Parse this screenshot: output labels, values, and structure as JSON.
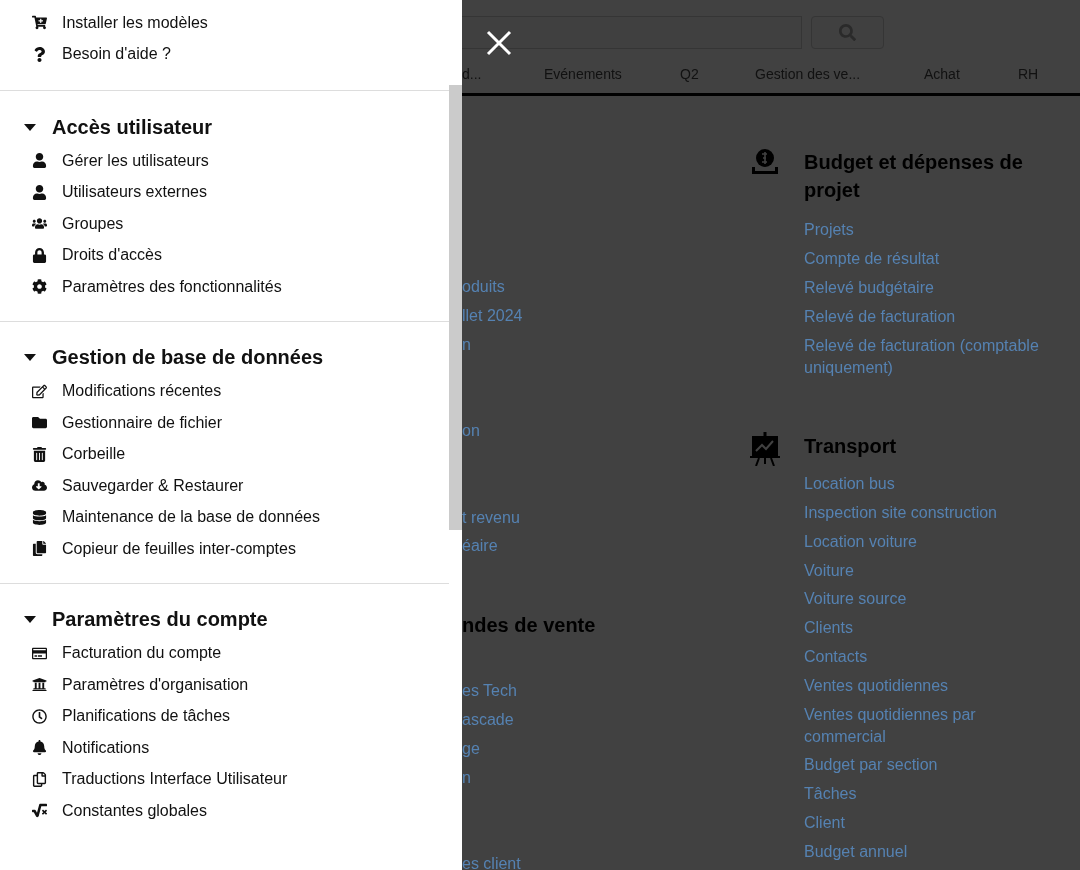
{
  "drawer": {
    "top_items": [
      {
        "label": "Installer les modèles"
      },
      {
        "label": "Besoin d'aide ?"
      }
    ],
    "sections": [
      {
        "title": "Accès utilisateur",
        "expanded": true,
        "items": [
          "Gérer les utilisateurs",
          "Utilisateurs externes",
          "Groupes",
          "Droits d'accès",
          "Paramètres des fonctionnalités"
        ]
      },
      {
        "title": "Gestion de base de données",
        "expanded": true,
        "items": [
          "Modifications récentes",
          "Gestionnaire de fichier",
          "Corbeille",
          "Sauvegarder & Restaurer",
          "Maintenance de la base de données",
          "Copieur de feuilles inter-comptes"
        ]
      },
      {
        "title": "Paramètres du compte",
        "expanded": true,
        "items": [
          "Facturation du compte",
          "Paramètres d'organisation",
          "Planifications de tâches",
          "Notifications",
          "Traductions Interface Utilisateur",
          "Constantes globales"
        ]
      }
    ]
  },
  "tabs": [
    "d...",
    "Evénements",
    "Q2",
    "Gestion des ve...",
    "Achat",
    "RH"
  ],
  "left_column": {
    "groups": [
      [
        "oduits",
        "llet 2024",
        "n"
      ],
      [
        "on"
      ],
      [
        "t revenu",
        "éaire"
      ]
    ],
    "section": {
      "title": "ndes de vente",
      "groups": [
        [
          "es Tech",
          "ascade",
          "ge",
          "n"
        ],
        [
          "es client"
        ]
      ]
    }
  },
  "right_column": [
    {
      "title": "Budget et dépenses de projet",
      "links": [
        "Projets",
        "Compte de résultat",
        "Relevé budgétaire",
        "Relevé de facturation",
        "Relevé de facturation (comptable uniquement)"
      ]
    },
    {
      "title": "Transport",
      "links": [
        "Location bus",
        "Inspection site construction",
        "Location voiture",
        "Voiture",
        "Voiture source",
        "Clients",
        "Contacts",
        "Ventes quotidiennes",
        "Ventes quotidiennes par commercial",
        "Budget par section",
        "Tâches",
        "Client",
        "Budget annuel"
      ]
    }
  ]
}
